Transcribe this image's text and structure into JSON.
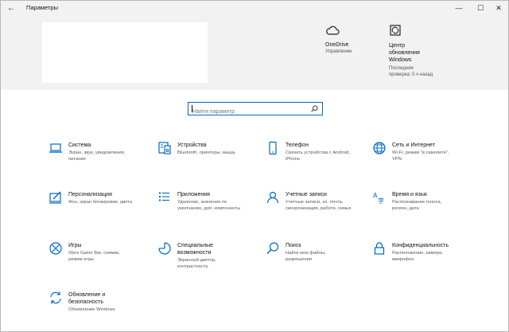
{
  "window": {
    "title": "Параметры",
    "back_glyph": "←",
    "minimize_glyph": "—",
    "maximize_glyph": "☐",
    "close_glyph": "✕"
  },
  "header": {
    "onedrive": {
      "title": "OneDrive",
      "subtitle": "Управление",
      "icon": "cloud-icon"
    },
    "update": {
      "title_lines": [
        "Центр",
        "обновления",
        "Windows"
      ],
      "subtitle_lines": [
        "Последняя",
        "проверка: 5 ч назад"
      ],
      "icon": "sync-icon"
    }
  },
  "search": {
    "placeholder": "Найти параметр",
    "value": ""
  },
  "accent_color": "#0067c0",
  "tiles": [
    {
      "id": "system",
      "icon": "laptop-icon",
      "title": [
        "Система"
      ],
      "desc": [
        "Экран, звук, уведомления,",
        "питание"
      ]
    },
    {
      "id": "devices",
      "icon": "keyboard-icon",
      "title": [
        "Устройства"
      ],
      "desc": [
        "Bluetooth, принтеры, мышь"
      ]
    },
    {
      "id": "phone",
      "icon": "phone-icon",
      "title": [
        "Телефон"
      ],
      "desc": [
        "Связать устройства с Android,",
        "iPhone"
      ]
    },
    {
      "id": "network",
      "icon": "globe-icon",
      "title": [
        "Сеть и Интернет"
      ],
      "desc": [
        "Wi-Fi, режим \"в самолете\",",
        "VPN"
      ]
    },
    {
      "id": "personalization",
      "icon": "paint-icon",
      "title": [
        "Персонализация"
      ],
      "desc": [
        "Фон, экран блокировки, цвета"
      ]
    },
    {
      "id": "apps",
      "icon": "apps-list-icon",
      "title": [
        "Приложения"
      ],
      "desc": [
        "Удаление, значения по",
        "умолчанию, доп. компоненты"
      ]
    },
    {
      "id": "accounts",
      "icon": "person-icon",
      "title": [
        "Учетные записи"
      ],
      "desc": [
        "Учетные записи, эл. почта,",
        "синхронизация, работа, семья"
      ]
    },
    {
      "id": "time",
      "icon": "time-language-icon",
      "title": [
        "Время и язык"
      ],
      "desc": [
        "Распознавание голоса,",
        "регион, дата"
      ]
    },
    {
      "id": "gaming",
      "icon": "xbox-icon",
      "title": [
        "Игры"
      ],
      "desc": [
        "Xbox Game Bar, снимки,",
        "режим игры"
      ]
    },
    {
      "id": "accessibility",
      "icon": "accessibility-icon",
      "title": [
        "Специальные",
        "возможности"
      ],
      "desc": [
        "Экранный диктор,",
        "контрастность"
      ]
    },
    {
      "id": "search",
      "icon": "magnifier-icon",
      "title": [
        "Поиск"
      ],
      "desc": [
        "Найти мои файлы,",
        "разрешения"
      ]
    },
    {
      "id": "privacy",
      "icon": "lock-icon",
      "title": [
        "Конфиденциальность"
      ],
      "desc": [
        "Расположение, камера,",
        "микрофон"
      ]
    },
    {
      "id": "update-security",
      "icon": "update-icon",
      "title": [
        "Обновление и",
        "безопасность"
      ],
      "desc": [
        "Обновление Windows"
      ]
    }
  ]
}
